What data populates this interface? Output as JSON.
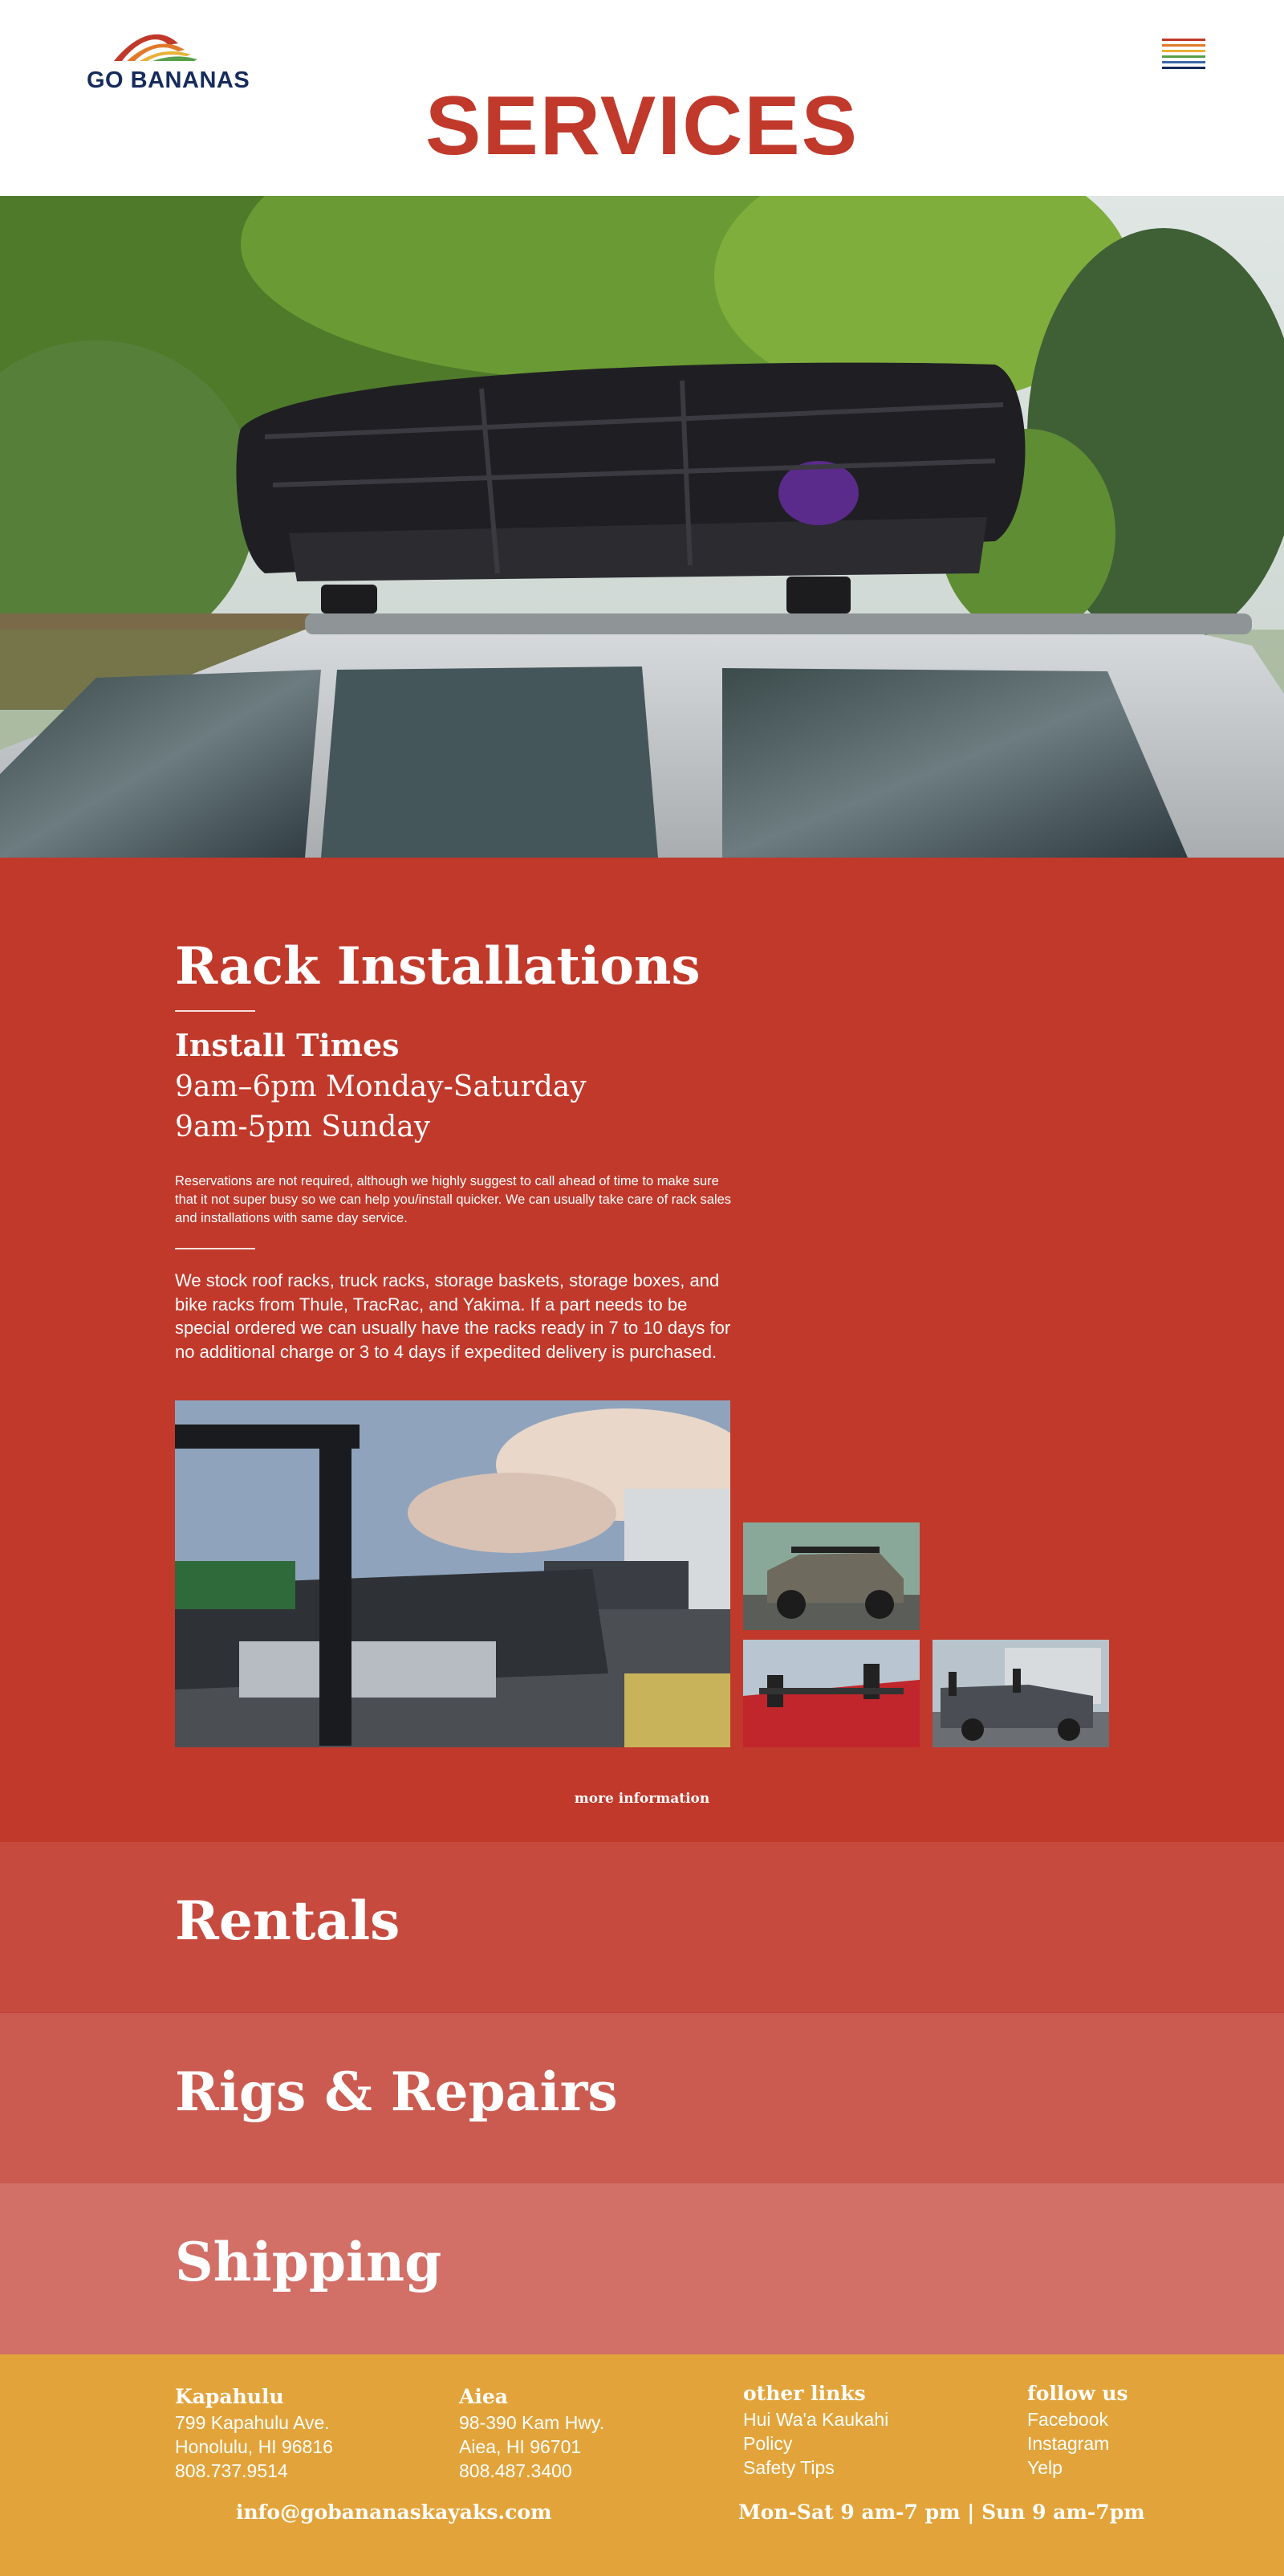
{
  "brand": {
    "logo_text": "GO BANANAS"
  },
  "header": {
    "title": "SERVICES"
  },
  "colors": {
    "primary_red": "#c0392b",
    "brand_navy": "#172b5c",
    "footer_yellow": "#e2a43a",
    "rentals_bg": "#c74a3e",
    "rigs_bg": "#cb5b50",
    "shipping_bg": "#d26f67"
  },
  "rack": {
    "title": "Rack Installations",
    "install_label": "Install Times",
    "hours_line1": "9am–6pm Monday-Saturday",
    "hours_line2": "9am-5pm Sunday",
    "note": "Reservations are not required, although we highly suggest to call ahead of time to make sure that it not super busy so we can help you/install quicker. We can usually take care of rack sales and installations with same day service.",
    "stock_text": "We stock roof racks, truck racks, storage baskets, storage boxes, and bike racks from Thule, TracRac, and Yakima. If a part needs to be special ordered we can usually have the racks ready in 7 to 10 days for no additional charge or 3 to 4 days if expedited delivery is purchased.",
    "more_info": "more information"
  },
  "sections": {
    "rentals": "Rentals",
    "rigs": "Rigs & Repairs",
    "shipping": "Shipping"
  },
  "footer": {
    "kapahulu": {
      "heading": "Kapahulu",
      "address1": "799 Kapahulu Ave.",
      "address2": "Honolulu, HI 96816",
      "phone": "808.737.9514"
    },
    "aiea": {
      "heading": "Aiea",
      "address1": "98-390 Kam Hwy.",
      "address2": "Aiea, HI 96701",
      "phone": "808.487.3400"
    },
    "other_links": {
      "heading": "other links",
      "links": [
        "Hui Wa'a Kaukahi",
        "Policy",
        "Safety Tips"
      ]
    },
    "follow_us": {
      "heading": "follow us",
      "links": [
        "Facebook",
        "Instagram",
        "Yelp"
      ]
    },
    "email": "info@gobananaskayaks.com",
    "hours": "Mon-Sat 9 am-7 pm | Sun 9 am-7pm"
  },
  "icons": {
    "menu": "hamburger-menu-icon",
    "logo": "rainbow-wave-logo"
  }
}
